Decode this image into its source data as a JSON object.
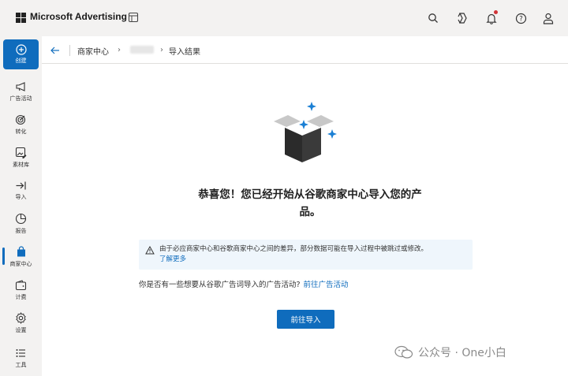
{
  "header": {
    "brand": "Microsoft Advertising",
    "icons": [
      "apps-icon",
      "search-icon",
      "copilot-icon",
      "bell-icon",
      "help-icon",
      "user-icon"
    ]
  },
  "sidebar": {
    "create_label": "创建",
    "items": [
      {
        "label": "广告活动",
        "icon": "megaphone-icon"
      },
      {
        "label": "转化",
        "icon": "target-icon"
      },
      {
        "label": "素材库",
        "icon": "image-edit-icon"
      },
      {
        "label": "导入",
        "icon": "import-icon"
      },
      {
        "label": "报告",
        "icon": "chart-icon"
      },
      {
        "label": "商家中心",
        "icon": "shopping-bag-icon"
      },
      {
        "label": "计费",
        "icon": "wallet-icon"
      },
      {
        "label": "设置",
        "icon": "gear-icon"
      },
      {
        "label": "工具",
        "icon": "tools-icon"
      }
    ]
  },
  "breadcrumb": {
    "items": [
      "商家中心",
      "导入结果"
    ]
  },
  "main": {
    "headline_line1": "恭喜您！您已经开始从谷歌商家中心导入您的产",
    "headline_line2": "品。",
    "info_text": "由于必应商家中心和谷歌商家中心之间的差异，部分数据可能在导入过程中被跳过或修改。",
    "info_link": "了解更多",
    "question": "你是否有一些想要从谷歌广告词导入的广告活动?",
    "question_link": "前往广告活动",
    "button": "前往导入"
  },
  "watermark": {
    "text": "公众号 · One小白"
  },
  "colors": {
    "accent": "#0f6cbd",
    "sparkle": "#1a7fd4",
    "box_dark": "#2b2b2b",
    "box_light": "#c8c8c8"
  }
}
